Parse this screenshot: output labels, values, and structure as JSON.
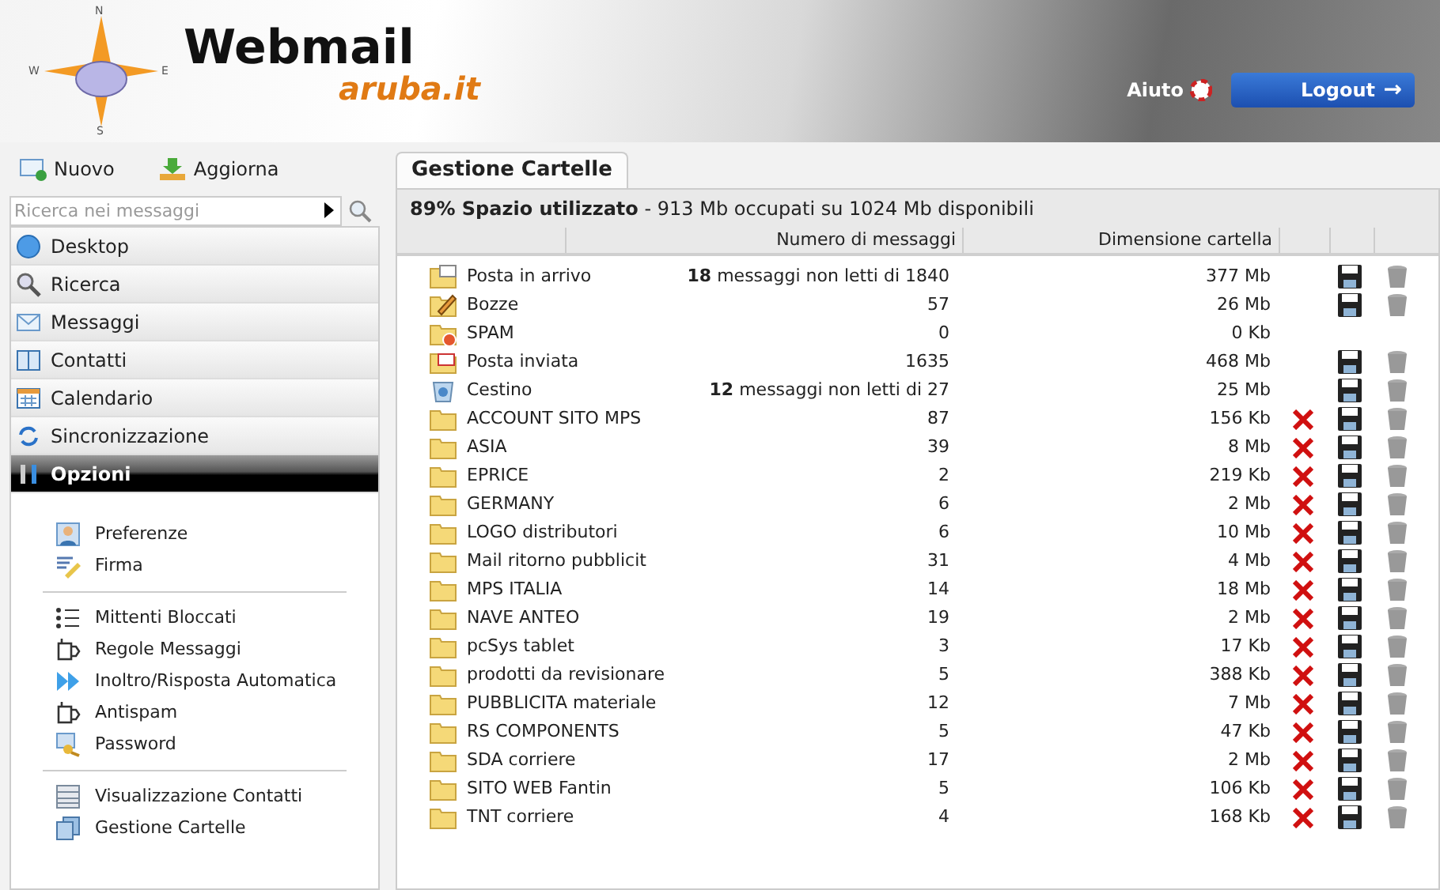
{
  "header": {
    "logo": {
      "compass": [
        "N",
        "W",
        "E",
        "S"
      ],
      "title": "Webmail",
      "subtitle": "aruba.it"
    },
    "help": "Aiuto",
    "logout": "Logout",
    "logout_arrow": "→"
  },
  "toolbar": [
    {
      "kind": "new",
      "label": "Nuovo"
    },
    {
      "kind": "refresh",
      "label": "Aggiorna"
    }
  ],
  "search": {
    "placeholder": "Ricerca nei messaggi"
  },
  "nav": [
    {
      "kind": "desktop",
      "label": "Desktop",
      "selected": false
    },
    {
      "kind": "search",
      "label": "Ricerca",
      "selected": false
    },
    {
      "kind": "mail",
      "label": "Messaggi",
      "selected": false
    },
    {
      "kind": "contacts",
      "label": "Contatti",
      "selected": false
    },
    {
      "kind": "calendar",
      "label": "Calendario",
      "selected": false
    },
    {
      "kind": "sync",
      "label": "Sincronizzazione",
      "selected": false
    },
    {
      "kind": "options",
      "label": "Opzioni",
      "selected": true
    }
  ],
  "options": [
    [
      {
        "kind": "user",
        "label": "Preferenze"
      },
      {
        "kind": "pen",
        "label": "Firma"
      }
    ],
    [
      {
        "kind": "list",
        "label": "Mittenti Bloccati"
      },
      {
        "kind": "rules",
        "label": "Regole Messaggi"
      },
      {
        "kind": "forward",
        "label": "Inoltro/Risposta Automatica"
      },
      {
        "kind": "rules",
        "label": "Antispam"
      },
      {
        "kind": "key",
        "label": "Password"
      }
    ],
    [
      {
        "kind": "view",
        "label": "Visualizzazione Contatti"
      },
      {
        "kind": "folders",
        "label": "Gestione Cartelle"
      }
    ]
  ],
  "tab": "Gestione Cartelle",
  "usage": {
    "summary": "89% Spazio utilizzato",
    "detail": "- 913 Mb occupati su 1024 Mb disponibili"
  },
  "table": {
    "columns": [
      "Numero di messaggi",
      "Dimensione cartella"
    ],
    "rows": [
      {
        "kind": "inbox",
        "name": "Posta in arrivo",
        "messages": "**18** messaggi non letti di 1840",
        "size": "377 Mb",
        "deletable": false,
        "exportable": true,
        "emptiable": true
      },
      {
        "kind": "drafts",
        "name": "Bozze",
        "messages": "57",
        "size": "26 Mb",
        "deletable": false,
        "exportable": true,
        "emptiable": true
      },
      {
        "kind": "spam",
        "name": "SPAM",
        "messages": "0",
        "size": "0 Kb",
        "deletable": false,
        "exportable": false,
        "emptiable": false
      },
      {
        "kind": "sent",
        "name": "Posta inviata",
        "messages": "1635",
        "size": "468 Mb",
        "deletable": false,
        "exportable": true,
        "emptiable": true
      },
      {
        "kind": "trash",
        "name": "Cestino",
        "messages": "**12** messaggi non letti di 27",
        "size": "25 Mb",
        "deletable": false,
        "exportable": true,
        "emptiable": true
      },
      {
        "kind": "folder",
        "name": "ACCOUNT SITO MPS",
        "messages": "87",
        "size": "156 Kb",
        "deletable": true,
        "exportable": true,
        "emptiable": true
      },
      {
        "kind": "folder",
        "name": "ASIA",
        "messages": "39",
        "size": "8 Mb",
        "deletable": true,
        "exportable": true,
        "emptiable": true
      },
      {
        "kind": "folder",
        "name": "EPRICE",
        "messages": "2",
        "size": "219 Kb",
        "deletable": true,
        "exportable": true,
        "emptiable": true
      },
      {
        "kind": "folder",
        "name": "GERMANY",
        "messages": "6",
        "size": "2 Mb",
        "deletable": true,
        "exportable": true,
        "emptiable": true
      },
      {
        "kind": "folder",
        "name": "LOGO distributori",
        "messages": "6",
        "size": "10 Mb",
        "deletable": true,
        "exportable": true,
        "emptiable": true
      },
      {
        "kind": "folder",
        "name": "Mail ritorno pubblicit",
        "messages": "31",
        "size": "4 Mb",
        "deletable": true,
        "exportable": true,
        "emptiable": true
      },
      {
        "kind": "folder",
        "name": "MPS ITALIA",
        "messages": "14",
        "size": "18 Mb",
        "deletable": true,
        "exportable": true,
        "emptiable": true
      },
      {
        "kind": "folder",
        "name": "NAVE ANTEO",
        "messages": "19",
        "size": "2 Mb",
        "deletable": true,
        "exportable": true,
        "emptiable": true
      },
      {
        "kind": "folder",
        "name": "pcSys tablet",
        "messages": "3",
        "size": "17 Kb",
        "deletable": true,
        "exportable": true,
        "emptiable": true
      },
      {
        "kind": "folder",
        "name": "prodotti da revisionare",
        "messages": "5",
        "size": "388 Kb",
        "deletable": true,
        "exportable": true,
        "emptiable": true
      },
      {
        "kind": "folder",
        "name": "PUBBLICITA materiale",
        "messages": "12",
        "size": "7 Mb",
        "deletable": true,
        "exportable": true,
        "emptiable": true
      },
      {
        "kind": "folder",
        "name": "RS COMPONENTS",
        "messages": "5",
        "size": "47 Kb",
        "deletable": true,
        "exportable": true,
        "emptiable": true
      },
      {
        "kind": "folder",
        "name": "SDA corriere",
        "messages": "17",
        "size": "2 Mb",
        "deletable": true,
        "exportable": true,
        "emptiable": true
      },
      {
        "kind": "folder",
        "name": "SITO WEB Fantin",
        "messages": "5",
        "size": "106 Kb",
        "deletable": true,
        "exportable": true,
        "emptiable": true
      },
      {
        "kind": "folder",
        "name": "TNT corriere",
        "messages": "4",
        "size": "168 Kb",
        "deletable": true,
        "exportable": true,
        "emptiable": true
      }
    ]
  }
}
